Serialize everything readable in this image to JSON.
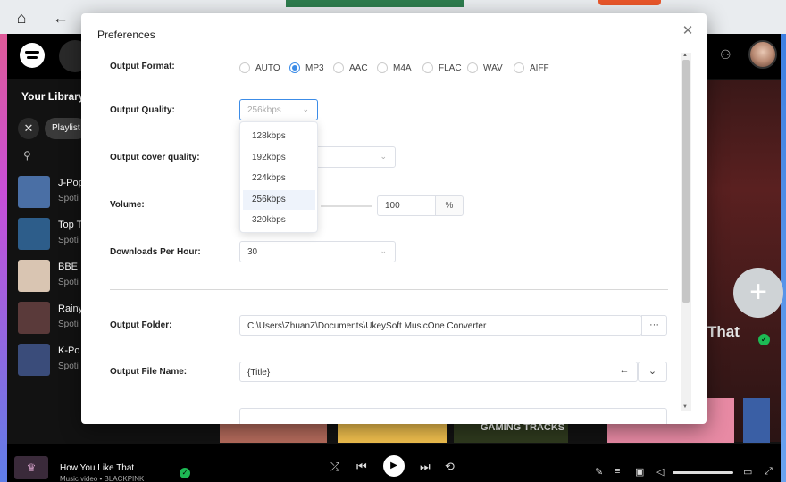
{
  "background": {
    "library_title": "Your Library",
    "chip_playlist": "Playlist",
    "library_items": [
      {
        "name": "J-Pop",
        "sub": "Spoti",
        "color": "#4a6fa5"
      },
      {
        "name": "Top T",
        "sub": "Spoti",
        "color": "#2d5d8a"
      },
      {
        "name": "BBE",
        "sub": "Spoti",
        "color": "#d9c5b2"
      },
      {
        "name": "Rainy",
        "sub": "Spoti",
        "color": "#5a3a3a"
      },
      {
        "name": "K-Po",
        "sub": "Spoti",
        "color": "#3a4c7a"
      }
    ],
    "right_text": "That",
    "tile_text": "GAMING TRACKS",
    "now_playing": {
      "title": "How You Like That",
      "sub": "Music video • BLACKPINK"
    }
  },
  "dialog": {
    "title": "Preferences",
    "labels": {
      "output_format": "Output Format:",
      "output_quality": "Output Quality:",
      "cover_quality": "Output cover quality:",
      "volume": "Volume:",
      "downloads_per_hour": "Downloads Per Hour:",
      "output_folder": "Output Folder:",
      "output_file_name": "Output File Name:"
    },
    "formats": [
      "AUTO",
      "MP3",
      "AAC",
      "M4A",
      "FLAC",
      "WAV",
      "AIFF"
    ],
    "selected_format": "MP3",
    "quality_value": "256kbps",
    "quality_options": [
      "128kbps",
      "192kbps",
      "224kbps",
      "256kbps",
      "320kbps"
    ],
    "volume_value": "100",
    "volume_unit": "%",
    "downloads_value": "30",
    "folder_value": "C:\\Users\\ZhuanZ\\Documents\\UkeySoft MusicOne Converter",
    "folder_browse": "···",
    "file_name_value": "{Title}",
    "back_arrow": "←",
    "chevron": "⌄"
  },
  "colors": {
    "accent": "#3c8ce7",
    "spotify_green": "#1db954"
  }
}
